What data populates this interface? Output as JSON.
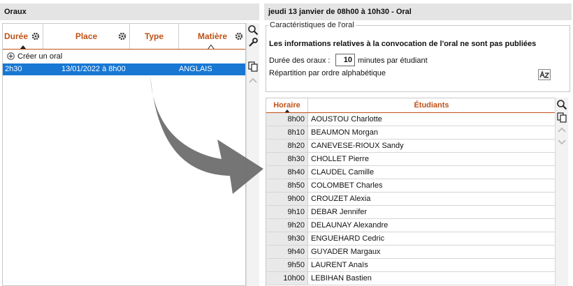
{
  "left_panel": {
    "title": "Oraux",
    "columns": [
      "Durée",
      "Place",
      "Type",
      "Matière"
    ],
    "create_label": "Créer un oral",
    "selected_row": {
      "duree": "2h30",
      "place": "13/01/2022 à 8h00",
      "type": "",
      "matiere": "ANGLAIS"
    }
  },
  "right_panel": {
    "title": "jeudi 13 janvier de 08h00 à 10h30 - Oral",
    "characteristics": {
      "legend": "Caractéristiques de l'oral",
      "info": "Les informations relatives à la convocation de l'oral ne sont pas publiées",
      "duration_label": "Durée des oraux :",
      "duration_value": "10",
      "duration_unit": "minutes par étudiant",
      "distribution": "Répartition par ordre alphabétique"
    },
    "table": {
      "headers": [
        "Horaire",
        "Étudiants"
      ],
      "rows": [
        {
          "time": "8h00",
          "name": "AOUSTOU Charlotte"
        },
        {
          "time": "8h10",
          "name": "BEAUMON Morgan"
        },
        {
          "time": "8h20",
          "name": "CANEVESE-RIOUX Sandy"
        },
        {
          "time": "8h30",
          "name": "CHOLLET Pierre"
        },
        {
          "time": "8h40",
          "name": "CLAUDEL Camille"
        },
        {
          "time": "8h50",
          "name": "COLOMBET Charles"
        },
        {
          "time": "9h00",
          "name": "CROUZET Alexia"
        },
        {
          "time": "9h10",
          "name": "DEBAR Jennifer"
        },
        {
          "time": "9h20",
          "name": "DELAUNAY Alexandre"
        },
        {
          "time": "9h30",
          "name": "ENGUEHARD Cedric"
        },
        {
          "time": "9h40",
          "name": "GUYADER Margaux"
        },
        {
          "time": "9h50",
          "name": "LAURENT Anaïs"
        },
        {
          "time": "10h00",
          "name": "LEBIHAN Bastien"
        }
      ]
    }
  },
  "colors": {
    "header_accent": "#c05217",
    "selection": "#1877d2",
    "arrow": "#6e6e6e"
  },
  "icons": [
    "gear-icon",
    "plus-circle-icon",
    "search-icon",
    "wrench-icon",
    "copy-icon",
    "chevron-up-icon",
    "chevron-down-icon",
    "sort-az-icon",
    "arrow-icon"
  ]
}
